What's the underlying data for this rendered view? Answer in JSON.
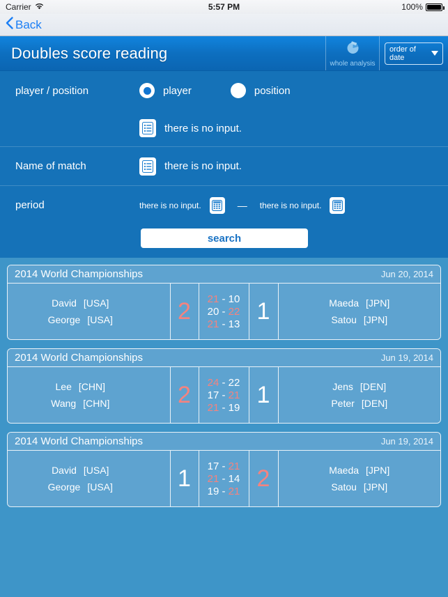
{
  "status_bar": {
    "carrier": "Carrier",
    "wifi_icon": "wifi-icon",
    "time": "5:57 PM",
    "battery_percent": "100%",
    "battery_icon": "battery-full-icon"
  },
  "nav_bar": {
    "back_label": "Back",
    "back_icon": "chevron-left-icon"
  },
  "header": {
    "title": "Doubles score reading",
    "analysis": {
      "icon": "pie-chart-icon",
      "label": "whole analysis"
    },
    "order_select": {
      "value": "order of date",
      "icon": "chevron-down-icon"
    }
  },
  "search_panel": {
    "player_position": {
      "label": "player / position",
      "options": [
        {
          "label": "player",
          "selected": true
        },
        {
          "label": "position",
          "selected": false
        }
      ],
      "input": {
        "icon": "list-icon",
        "value": "there is no input."
      }
    },
    "name_of_match": {
      "label": "Name of match",
      "input": {
        "icon": "list-icon",
        "value": "there is no input."
      }
    },
    "period": {
      "label": "period",
      "separator": "—",
      "from": {
        "value": "there is no input.",
        "icon": "calendar-icon"
      },
      "to": {
        "value": "there is no input.",
        "icon": "calendar-icon"
      }
    },
    "search_button": "search"
  },
  "results": [
    {
      "match_name": "2014 World Championships",
      "date": "Jun 20, 2014",
      "left_team": {
        "players": [
          {
            "name": "David",
            "country": "[USA]"
          },
          {
            "name": "George",
            "country": "[USA]"
          }
        ],
        "games_won": "2",
        "winner": true
      },
      "right_team": {
        "players": [
          {
            "name": "Maeda",
            "country": "[JPN]"
          },
          {
            "name": "Satou",
            "country": "[JPN]"
          }
        ],
        "games_won": "1",
        "winner": false
      },
      "sets": [
        {
          "left": "21",
          "right": "10",
          "left_won": true
        },
        {
          "left": "20",
          "right": "22",
          "left_won": false
        },
        {
          "left": "21",
          "right": "13",
          "left_won": true
        }
      ]
    },
    {
      "match_name": "2014 World Championships",
      "date": "Jun 19, 2014",
      "left_team": {
        "players": [
          {
            "name": "Lee",
            "country": "[CHN]"
          },
          {
            "name": "Wang",
            "country": "[CHN]"
          }
        ],
        "games_won": "2",
        "winner": true
      },
      "right_team": {
        "players": [
          {
            "name": "Jens",
            "country": "[DEN]"
          },
          {
            "name": "Peter",
            "country": "[DEN]"
          }
        ],
        "games_won": "1",
        "winner": false
      },
      "sets": [
        {
          "left": "24",
          "right": "22",
          "left_won": true
        },
        {
          "left": "17",
          "right": "21",
          "left_won": false
        },
        {
          "left": "21",
          "right": "19",
          "left_won": true
        }
      ]
    },
    {
      "match_name": "2014 World Championships",
      "date": "Jun 19, 2014",
      "left_team": {
        "players": [
          {
            "name": "David",
            "country": "[USA]"
          },
          {
            "name": "George",
            "country": "[USA]"
          }
        ],
        "games_won": "1",
        "winner": false
      },
      "right_team": {
        "players": [
          {
            "name": "Maeda",
            "country": "[JPN]"
          },
          {
            "name": "Satou",
            "country": "[JPN]"
          }
        ],
        "games_won": "2",
        "winner": true
      },
      "sets": [
        {
          "left": "17",
          "right": "21",
          "left_won": false
        },
        {
          "left": "21",
          "right": "14",
          "left_won": true
        },
        {
          "left": "19",
          "right": "21",
          "left_won": false
        }
      ]
    }
  ],
  "colors": {
    "header_blue": "#0d6fc0",
    "panel_blue": "#1572b8",
    "page_blue": "#3e95c8",
    "card_blue": "#5ea3d0",
    "winner_red": "#f4837f",
    "link_blue": "#1a7ef5"
  }
}
